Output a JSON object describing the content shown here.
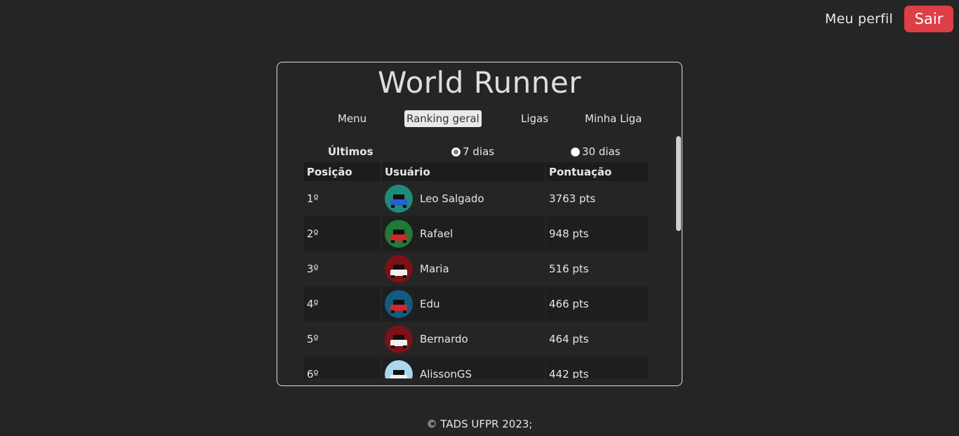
{
  "header": {
    "profile_label": "Meu perfil",
    "logout_label": "Sair"
  },
  "app": {
    "title": "World Runner"
  },
  "nav": {
    "items": [
      {
        "label": "Menu",
        "active": false
      },
      {
        "label": "Ranking geral",
        "active": true
      },
      {
        "label": "Ligas",
        "active": false
      },
      {
        "label": "Minha Liga",
        "active": false
      }
    ]
  },
  "period": {
    "label": "Últimos",
    "options": [
      {
        "label": "7 dias",
        "checked": true
      },
      {
        "label": "30 dias",
        "checked": false
      }
    ]
  },
  "table": {
    "headers": [
      "Posição",
      "Usuário",
      "Pontuação"
    ],
    "rows": [
      {
        "position": "1º",
        "user": "Leo Salgado",
        "score": "3763 pts",
        "avatar_color": "#1f8a7a",
        "car_color": "#2a5fd0"
      },
      {
        "position": "2º",
        "user": "Rafael",
        "score": "948 pts",
        "avatar_color": "#1e7a34",
        "car_color": "#d0262e"
      },
      {
        "position": "3º",
        "user": "Maria",
        "score": "516 pts",
        "avatar_color": "#7a1218",
        "car_color": "#f0f0f0"
      },
      {
        "position": "4º",
        "user": "Edu",
        "score": "466 pts",
        "avatar_color": "#0f5c80",
        "car_color": "#d0262e"
      },
      {
        "position": "5º",
        "user": "Bernardo",
        "score": "464 pts",
        "avatar_color": "#7a1218",
        "car_color": "#f0f0f0"
      },
      {
        "position": "6º",
        "user": "AlissonGS",
        "score": "442 pts",
        "avatar_color": "#a9d8ef",
        "car_color": "#f0f0f0"
      }
    ]
  },
  "footer": {
    "text": "© TADS UFPR 2023;"
  },
  "colors": {
    "background": "#252525",
    "logout": "#dc3f46",
    "header_cell": "#1c1c1c",
    "row_alt": "#1e1e1e"
  }
}
